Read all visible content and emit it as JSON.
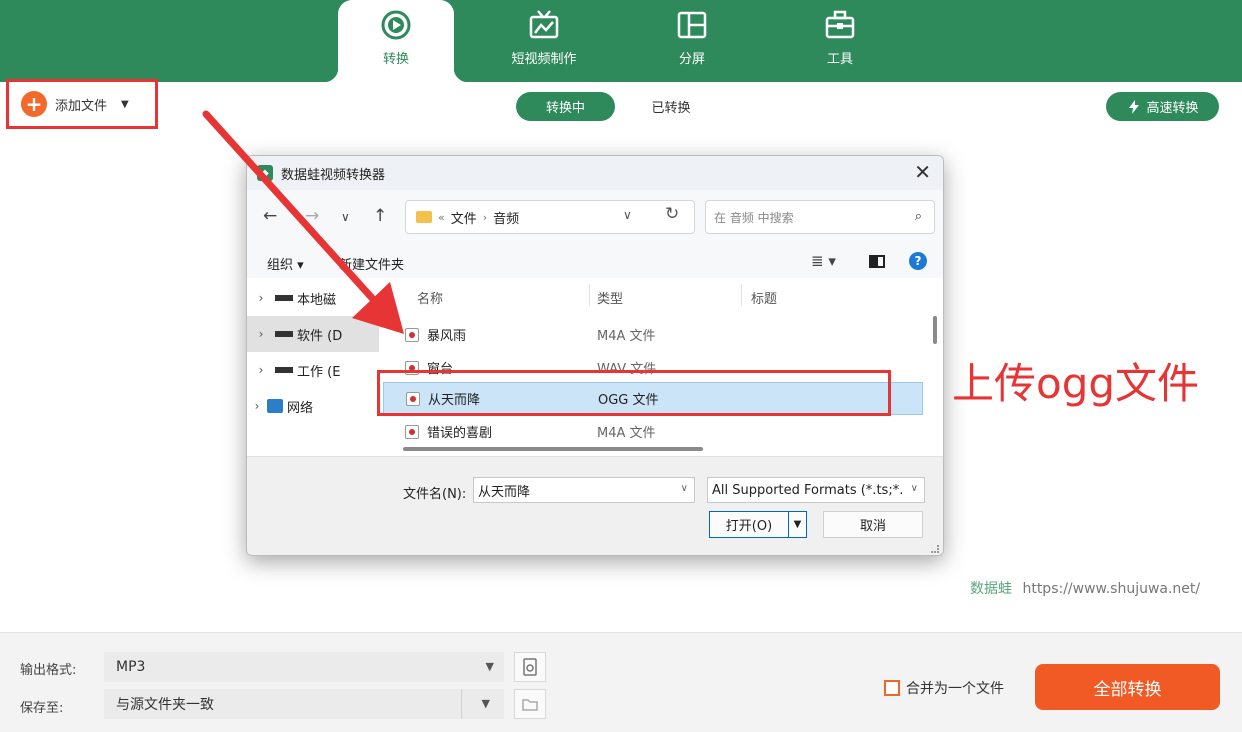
{
  "colors": {
    "brand_green": "#2e8a5a",
    "accent_orange": "#f15a24",
    "annotation_red": "#e73535"
  },
  "tabs": [
    {
      "label": "转换",
      "icon": "convert-icon",
      "active": true
    },
    {
      "label": "短视频制作",
      "icon": "tv-icon",
      "active": false
    },
    {
      "label": "分屏",
      "icon": "split-screen-icon",
      "active": false
    },
    {
      "label": "工具",
      "icon": "toolbox-icon",
      "active": false
    }
  ],
  "toolbar": {
    "add_file": "添加文件",
    "converting": "转换中",
    "converted": "已转换",
    "fast_convert": "高速转换"
  },
  "dialog": {
    "title": "数据蛙视频转换器",
    "breadcrumb": [
      "文件",
      "音频"
    ],
    "search_placeholder": "在 音频 中搜索",
    "organize": "组织",
    "new_folder": "新建文件夹",
    "tree": [
      {
        "label": "本地磁",
        "icon": "drive-icon"
      },
      {
        "label": "软件 (D",
        "icon": "drive-icon"
      },
      {
        "label": "工作 (E",
        "icon": "drive-icon"
      },
      {
        "label": "网络",
        "icon": "network-icon"
      }
    ],
    "columns": {
      "name": "名称",
      "type": "类型",
      "title": "标题"
    },
    "files": [
      {
        "name": "暴风雨",
        "type": "M4A 文件"
      },
      {
        "name": "窗台",
        "type": "WAV 文件"
      },
      {
        "name": "从天而降",
        "type": "OGG 文件"
      },
      {
        "name": "错误的喜剧",
        "type": "M4A 文件"
      }
    ],
    "filename_label": "文件名(N):",
    "filename_value": "从天而降",
    "format_filter": "All Supported Formats (*.ts;*.",
    "open": "打开(O)",
    "cancel": "取消"
  },
  "annotation_text": "上传ogg文件",
  "watermark": {
    "brand": "数据蛙",
    "url": "https://www.shujuwa.net/"
  },
  "bottom": {
    "output_format_label": "输出格式:",
    "output_format_value": "MP3",
    "save_to_label": "保存至:",
    "save_to_value": "与源文件夹一致",
    "merge_label": "合并为一个文件",
    "convert_all": "全部转换"
  }
}
